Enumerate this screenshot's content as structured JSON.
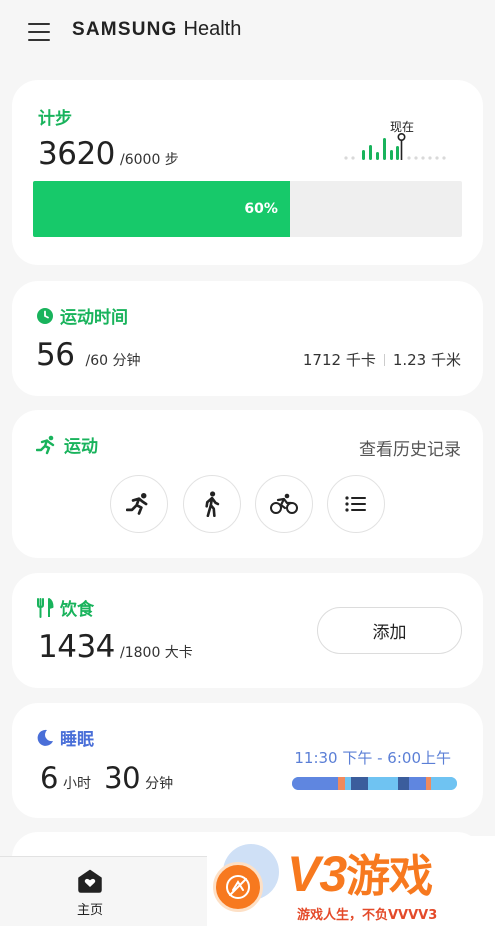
{
  "header": {
    "brand": "SAMSUNG",
    "product": "Health",
    "menu_icon": "hamburger-menu-icon"
  },
  "steps": {
    "label": "计步",
    "value": "3620",
    "goal": "/6000 步",
    "now_label": "现在",
    "progress": 0.6,
    "progress_text": "60%",
    "colors": {
      "accent": "#19b35c",
      "fill": "#17c96a",
      "track": "#efefef"
    }
  },
  "active_time": {
    "label": "运动时间",
    "icon": "clock-icon",
    "value": "56",
    "goal": "/60 分钟",
    "calories": "1712 千卡",
    "distance": "1.23 千米"
  },
  "exercise": {
    "label": "运动",
    "icon": "running-person-icon",
    "history_link": "查看历史记录",
    "buttons": [
      {
        "name": "running-icon"
      },
      {
        "name": "walking-icon"
      },
      {
        "name": "cycling-icon"
      },
      {
        "name": "list-icon"
      }
    ]
  },
  "food": {
    "label": "饮食",
    "icon": "fork-knife-icon",
    "value": "1434",
    "goal": "/1800 大卡",
    "add_label": "添加"
  },
  "sleep": {
    "label": "睡眠",
    "icon": "moon-icon",
    "hours": "6",
    "hours_unit": "小时",
    "minutes": "30",
    "minutes_unit": "分钟",
    "range": "11:30 下午 - 6:00上午",
    "colors": {
      "accent": "#4a6fd8",
      "light": "#6fc3f2",
      "deep": "#3b5d9c",
      "awake": "#f08a5d"
    }
  },
  "bottom_nav": {
    "home_label": "主页",
    "home_icon": "home-heart-icon"
  },
  "watermark": {
    "brand": "V3",
    "name": "游戏",
    "slogan": "游戏人生，不负VVVV3",
    "color": "#f7791f"
  }
}
